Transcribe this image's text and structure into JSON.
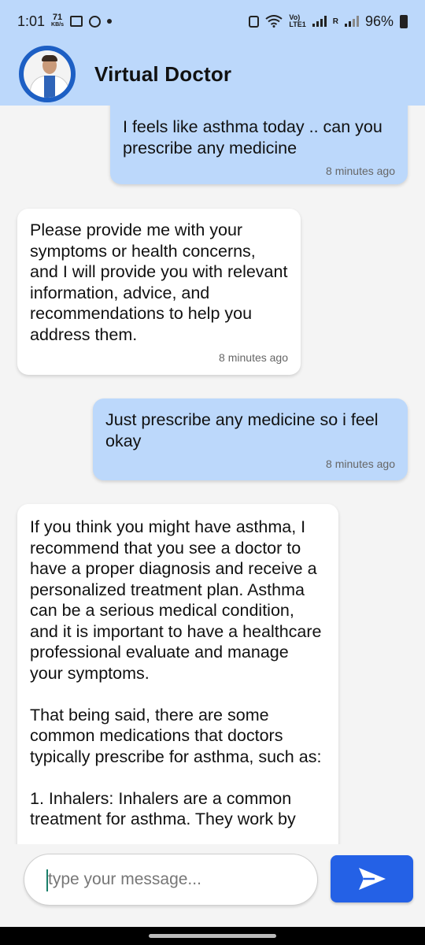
{
  "status_bar": {
    "time": "1:01",
    "speed_value": "71",
    "speed_unit": "KB/s",
    "network_label_top": "Vo)",
    "network_label_bottom": "LTE1",
    "sim2_label": "R",
    "battery": "96%"
  },
  "header": {
    "title": "Virtual Doctor",
    "avatar_icon": "doctor-avatar"
  },
  "messages": [
    {
      "sender": "user",
      "text": "I feels like asthma today .. can you prescribe any medicine",
      "time": "8 minutes ago"
    },
    {
      "sender": "bot",
      "text": "Please provide me with your symptoms or health concerns, and I will provide you with relevant information, advice, and recommendations to help you address them.",
      "time": "8 minutes ago"
    },
    {
      "sender": "user",
      "text": "Just prescribe any medicine so i feel okay",
      "time": "8 minutes ago"
    },
    {
      "sender": "bot",
      "text": "If you think you might have asthma, I recommend that you see a doctor to have a proper diagnosis and receive a personalized treatment plan. Asthma can be a serious medical condition, and it is important to have a healthcare professional evaluate and manage your symptoms.\n\nThat being said, there are some common medications that doctors typically prescribe for asthma, such as:\n\n1. Inhalers: Inhalers are a common treatment for asthma. They work by"
    }
  ],
  "input": {
    "placeholder": "type your message...",
    "send_icon": "send-icon"
  },
  "colors": {
    "header_bg": "#bcd8fb",
    "user_bubble": "#bcd8fb",
    "bot_bubble": "#ffffff",
    "send_button": "#2461e6",
    "background": "#f4f4f4"
  }
}
